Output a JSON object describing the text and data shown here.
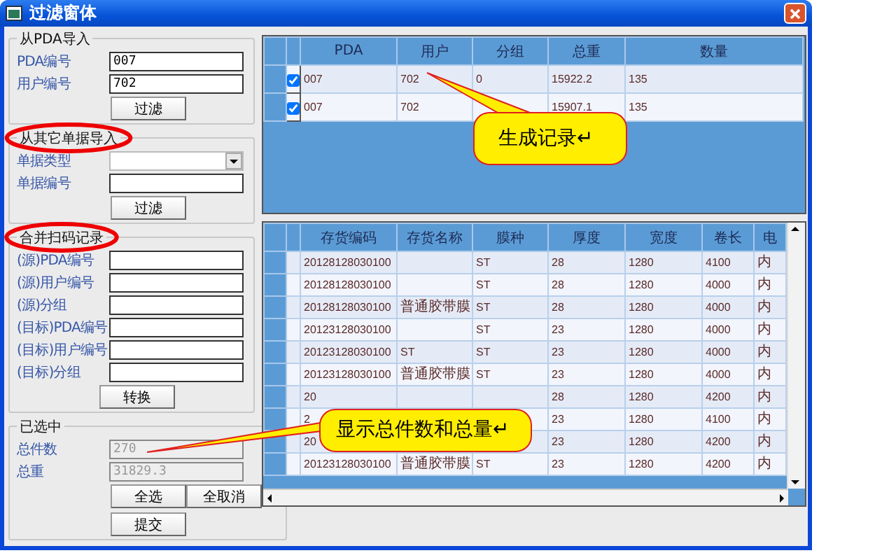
{
  "window": {
    "title": "过滤窗体"
  },
  "groups": [
    {
      "title": "从PDA导入",
      "circled": false,
      "fields": [
        {
          "kind": "text",
          "label": "PDA编号",
          "value": "007",
          "disabled": false
        },
        {
          "kind": "text",
          "label": "用户编号",
          "value": "702",
          "disabled": false
        }
      ],
      "buttons": [
        "过滤"
      ]
    },
    {
      "title": "从其它单据导入",
      "circled": true,
      "fields": [
        {
          "kind": "dropdown",
          "label": "单据类型",
          "disabled": false
        },
        {
          "kind": "text",
          "label": "单据编号",
          "disabled": false
        }
      ],
      "buttons": [
        "过滤"
      ]
    },
    {
      "title": "合并扫码记录",
      "circled": true,
      "fields": [
        {
          "kind": "text",
          "label": "(源)PDA编号",
          "disabled": false
        },
        {
          "kind": "text",
          "label": "(源)用户编号",
          "disabled": false
        },
        {
          "kind": "text",
          "label": "(源)分组",
          "disabled": false
        },
        {
          "kind": "text",
          "label": "(目标)PDA编号",
          "disabled": false
        },
        {
          "kind": "text",
          "label": "(目标)用户编号",
          "disabled": false
        },
        {
          "kind": "text",
          "label": "(目标)分组",
          "disabled": false
        }
      ],
      "buttons": [
        "转换"
      ]
    },
    {
      "title": "已选中",
      "circled": false,
      "fields": [
        {
          "kind": "text",
          "label": "总件数",
          "value": "270",
          "disabled": true
        },
        {
          "kind": "text",
          "label": "总重",
          "value": "31829.3",
          "disabled": true
        }
      ],
      "buttons": [
        "全选",
        "全取消",
        "提交"
      ]
    }
  ],
  "top_grid": {
    "columns": [
      "PDA",
      "用户",
      "分组",
      "总重",
      "数量"
    ],
    "rows": [
      {
        "checked": true,
        "cells": [
          "007",
          "702",
          "0",
          "15922.2",
          "135"
        ]
      },
      {
        "checked": true,
        "cells": [
          "007",
          "702",
          null,
          "15907.1",
          "135"
        ]
      }
    ]
  },
  "bottom_grid": {
    "columns": [
      "存货编码",
      "存货名称",
      "膜种",
      "厚度",
      "宽度",
      "卷长",
      "电"
    ],
    "rows": [
      {
        "cells": [
          "20128128030100",
          null,
          "ST",
          "28",
          "1280",
          "4100",
          "内"
        ]
      },
      {
        "cells": [
          "20128128030100",
          null,
          "ST",
          "28",
          "1280",
          "4000",
          "内"
        ]
      },
      {
        "cells": [
          "20128128030100",
          "普通胶带膜",
          "ST",
          "28",
          "1280",
          "4000",
          "内"
        ]
      },
      {
        "cells": [
          "20123128030100",
          null,
          "ST",
          "23",
          "1280",
          "4000",
          "内"
        ]
      },
      {
        "cells": [
          "20123128030100",
          "ST",
          "ST",
          "23",
          "1280",
          "4000",
          "内"
        ]
      },
      {
        "cells": [
          "20123128030100",
          "普通胶带膜",
          "ST",
          "23",
          "1280",
          "4000",
          "内"
        ]
      },
      {
        "cells": [
          "20",
          null,
          null,
          "28",
          "1280",
          "4200",
          "内"
        ]
      },
      {
        "cells": [
          "2",
          null,
          null,
          "23",
          "1280",
          "4100",
          "内"
        ]
      },
      {
        "cells": [
          "20",
          null,
          null,
          "23",
          "1280",
          "4200",
          "内"
        ]
      },
      {
        "cells": [
          "20123128030100",
          "普通胶带膜",
          "ST",
          "23",
          "1280",
          "4200",
          "内"
        ]
      }
    ]
  },
  "callouts": [
    {
      "text": "生成记录↵"
    },
    {
      "text": "显示总件数和总量↵"
    }
  ]
}
